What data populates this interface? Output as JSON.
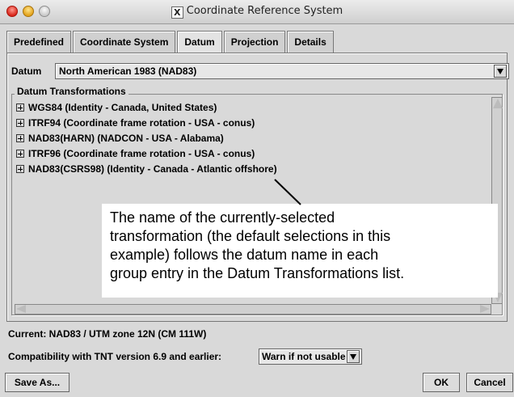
{
  "window": {
    "title": "Coordinate Reference System",
    "title_icon": "X"
  },
  "tabs": [
    {
      "label": "Predefined"
    },
    {
      "label": "Coordinate System"
    },
    {
      "label": "Datum"
    },
    {
      "label": "Projection"
    },
    {
      "label": "Details"
    }
  ],
  "datum": {
    "label": "Datum",
    "selected": "North American 1983 (NAD83)"
  },
  "transformations": {
    "title": "Datum Transformations",
    "items": [
      {
        "label": "WGS84 (Identity - Canada, United States)"
      },
      {
        "label": "ITRF94 (Coordinate frame rotation - USA - conus)"
      },
      {
        "label": "NAD83(HARN) (NADCON - USA - Alabama)"
      },
      {
        "label": "ITRF96 (Coordinate frame rotation - USA - conus)"
      },
      {
        "label": "NAD83(CSRS98) (Identity - Canada - Atlantic offshore)"
      }
    ]
  },
  "callout": {
    "lines": [
      "The name of the currently-selected",
      "transformation (the default selections in this",
      "example) follows the datum name in each",
      "group entry in the Datum Transformations list."
    ]
  },
  "current": "Current: NAD83 / UTM zone 12N (CM 111W)",
  "compatibility": {
    "label": "Compatibility with TNT version 6.9 and earlier:",
    "selected": "Warn if not usable"
  },
  "buttons": {
    "save_as": "Save As...",
    "ok": "OK",
    "cancel": "Cancel"
  }
}
